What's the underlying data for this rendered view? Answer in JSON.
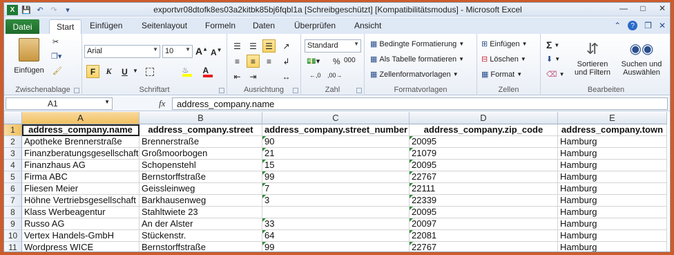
{
  "window": {
    "title": "exportvr08dtofk8es03a2kitbk85bj6fqbl1a  [Schreibgeschützt]  [Kompatibilitätsmodus]  -  Microsoft Excel"
  },
  "tabs": {
    "file": "Datei",
    "items": [
      "Start",
      "Einfügen",
      "Seitenlayout",
      "Formeln",
      "Daten",
      "Überprüfen",
      "Ansicht"
    ],
    "active": "Start"
  },
  "ribbon": {
    "clipboard": {
      "label": "Zwischenablage",
      "paste": "Einfügen"
    },
    "font": {
      "label": "Schriftart",
      "family": "Arial",
      "size": "10"
    },
    "alignment": {
      "label": "Ausrichtung"
    },
    "number": {
      "label": "Zahl",
      "format": "Standard"
    },
    "styles": {
      "label": "Formatvorlagen",
      "conditional": "Bedingte Formatierung",
      "as_table": "Als Tabelle formatieren",
      "cell_styles": "Zellenformatvorlagen"
    },
    "cells": {
      "label": "Zellen",
      "insert": "Einfügen",
      "delete": "Löschen",
      "format": "Format"
    },
    "editing": {
      "label": "Bearbeiten",
      "sort1": "Sortieren",
      "sort2": "und Filtern",
      "find1": "Suchen und",
      "find2": "Auswählen"
    }
  },
  "formula_bar": {
    "name_box": "A1",
    "fx": "fx",
    "content": "address_company.name"
  },
  "sheet": {
    "columns": [
      "A",
      "B",
      "C",
      "D",
      "E"
    ],
    "rows": [
      [
        "address_company.name",
        "address_company.street",
        "address_company.street_number",
        "address_company.zip_code",
        "address_company.town"
      ],
      [
        "Apotheke Brennerstraße",
        "Brennerstraße",
        "90",
        "20095",
        "Hamburg"
      ],
      [
        "Finanzberatungsgesellschaft",
        "Großmoorbogen",
        "21",
        "21079",
        "Hamburg"
      ],
      [
        "Finanzhaus AG",
        "Schopenstehl",
        "15",
        "20095",
        "Hamburg"
      ],
      [
        "Firma ABC",
        "Bernstorffstraße",
        "99",
        "22767",
        "Hamburg"
      ],
      [
        "Fliesen Meier",
        "Geissleinweg",
        "7",
        "22111",
        "Hamburg"
      ],
      [
        "Höhne Vertriebsgesellschaft",
        "Barkhausenweg",
        "3",
        "22339",
        "Hamburg"
      ],
      [
        "Klass Werbeagentur",
        "Stahltwiete 23",
        "",
        "20095",
        "Hamburg"
      ],
      [
        "Russo AG",
        "An der Alster",
        "33",
        "20097",
        "Hamburg"
      ],
      [
        "Vertex Handels-GmbH",
        "Stückenstr.",
        "64",
        "22081",
        "Hamburg"
      ],
      [
        "Wordpress WICE",
        "Bernstorffstraße",
        "99",
        "22767",
        "Hamburg"
      ]
    ]
  }
}
